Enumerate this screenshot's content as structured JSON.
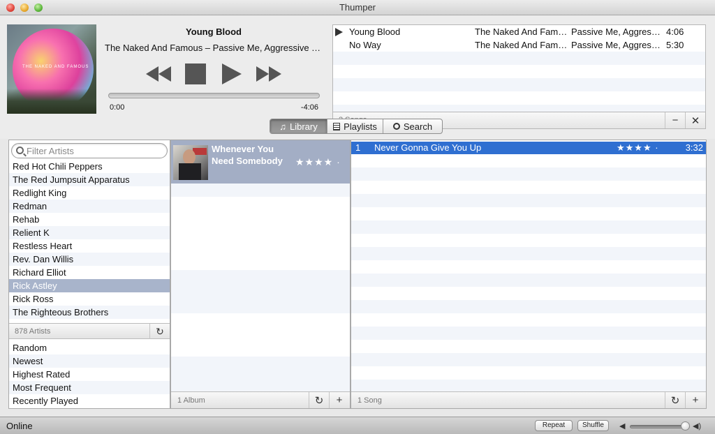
{
  "window": {
    "title": "Thumper"
  },
  "now_playing": {
    "title": "Young Blood",
    "subtitle": "The Naked And Famous – Passive Me, Aggressive You",
    "elapsed": "0:00",
    "remaining": "-4:06",
    "progress": 0,
    "art_text": "THE NAKED AND FAMOUS"
  },
  "queue": {
    "rows": [
      {
        "title": "Young Blood",
        "artist": "The Naked And Famous",
        "album": "Passive Me, Aggressive You",
        "time": "4:06",
        "playing": true
      },
      {
        "title": "No Way",
        "artist": "The Naked And Famous",
        "album": "Passive Me, Aggressive You",
        "time": "5:30",
        "playing": false
      }
    ],
    "count": "2 Songs",
    "remove_label": "−",
    "clear_label": "✕"
  },
  "tabs": [
    {
      "label": "Library",
      "icon": "music-note-icon",
      "active": true
    },
    {
      "label": "Playlists",
      "icon": "list-icon",
      "active": false
    },
    {
      "label": "Search",
      "icon": "search-icon",
      "active": false
    }
  ],
  "artists": {
    "filter_placeholder": "Filter Artists",
    "items": [
      "Red Hot Chili Peppers",
      "The Red Jumpsuit Apparatus",
      "Redlight King",
      "Redman",
      "Rehab",
      "Relient K",
      "Restless Heart",
      "Rev. Dan Willis",
      "Richard Elliot",
      "Rick Astley",
      "Rick Ross",
      "The Righteous Brothers"
    ],
    "selected_index": 9,
    "count": "878 Artists",
    "refresh_label": "↻"
  },
  "smart_lists": [
    "Random",
    "Newest",
    "Highest Rated",
    "Most Frequent",
    "Recently Played"
  ],
  "albums": {
    "items": [
      {
        "title": "Whenever You Need Somebody",
        "stars": "★★★★ ·"
      }
    ],
    "count": "1 Album",
    "refresh_label": "↻",
    "add_label": "+"
  },
  "songs": {
    "items": [
      {
        "number": "1",
        "title": "Never Gonna Give You Up",
        "stars": "★★★★ ·",
        "duration": "3:32"
      }
    ],
    "count": "1 Song",
    "refresh_label": "↻",
    "add_label": "+"
  },
  "status": {
    "text": "Online",
    "repeat_label": "Repeat",
    "shuffle_label": "Shuffle",
    "volume": 0.9
  },
  "icons": {
    "prev": "rewind-icon",
    "stop": "stop-icon",
    "play": "play-icon",
    "next": "fast-forward-icon"
  }
}
